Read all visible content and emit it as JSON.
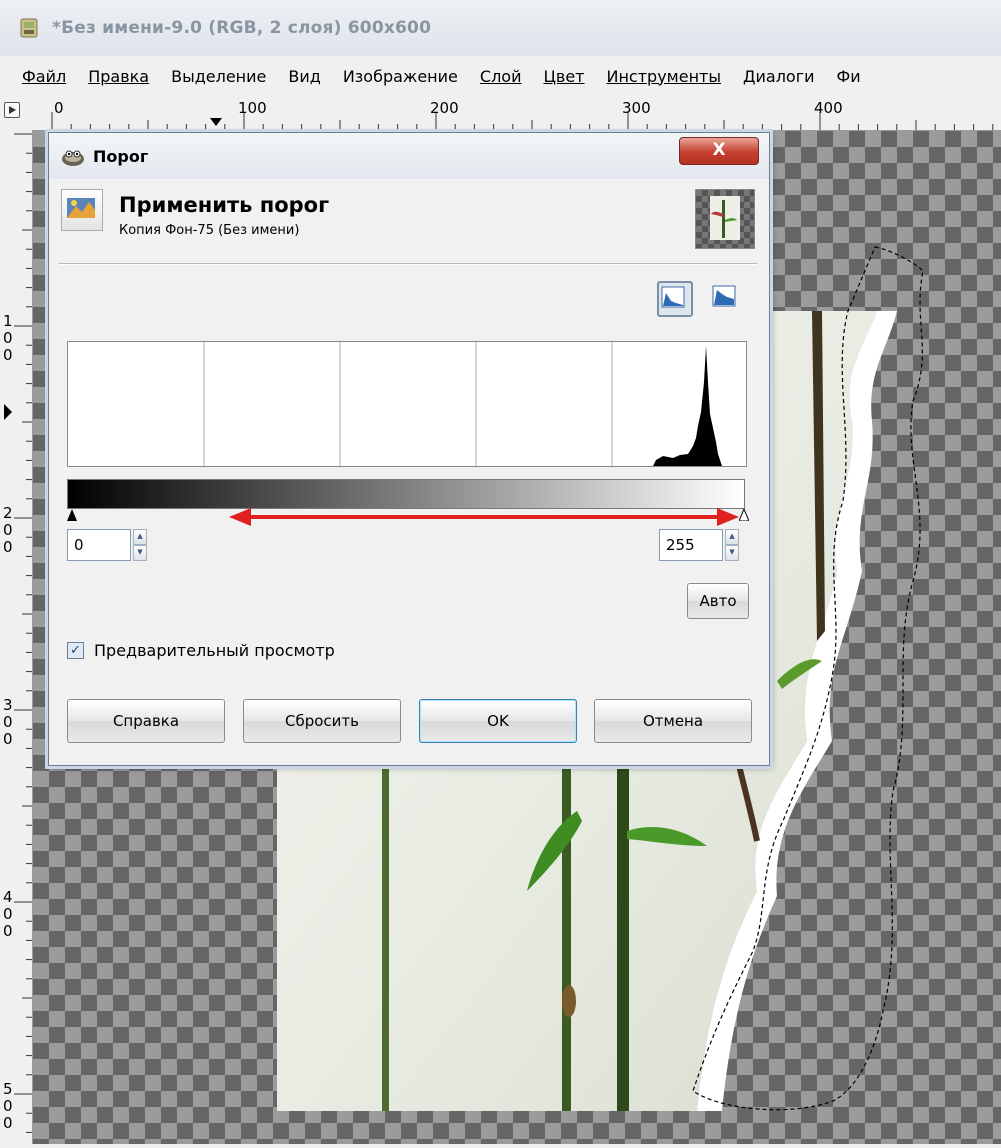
{
  "window": {
    "title": "*Без имени-9.0 (RGB, 2 слоя) 600x600",
    "icon": "gimp-app-icon"
  },
  "menubar": {
    "items": [
      {
        "label": "Файл"
      },
      {
        "label": "Правка"
      },
      {
        "label": "Выделение"
      },
      {
        "label": "Вид"
      },
      {
        "label": "Изображение"
      },
      {
        "label": "Слой"
      },
      {
        "label": "Цвет"
      },
      {
        "label": "Инструменты"
      },
      {
        "label": "Диалоги"
      },
      {
        "label": "Фи"
      }
    ]
  },
  "rulers": {
    "horizontal_labels": [
      "0",
      "100",
      "200",
      "300",
      "400"
    ],
    "vertical_labels": [
      "1\n0\n0",
      "2\n0\n0",
      "3\n0\n0",
      "4\n0\n0",
      "5\n0\n0"
    ]
  },
  "dialog": {
    "title": "Порог",
    "close_label": "X",
    "heading": "Применить порог",
    "subheading": "Копия Фон-75 (Без имени)",
    "scale": {
      "linear_icon": "linear-histogram-icon",
      "log_icon": "logarithmic-histogram-icon",
      "selected": "linear"
    },
    "threshold": {
      "low": "0",
      "high": "255",
      "min": 0,
      "max": 255
    },
    "auto_label": "Авто",
    "preview": {
      "label": "Предварительный просмотр",
      "checked": true
    },
    "buttons": {
      "help": "Справка",
      "reset": "Сбросить",
      "ok": "OK",
      "cancel": "Отмена"
    }
  },
  "colors": {
    "annotation_arrow": "#e0201c",
    "close_button": "#c6402f",
    "ok_focus": "#3c7fb1"
  }
}
